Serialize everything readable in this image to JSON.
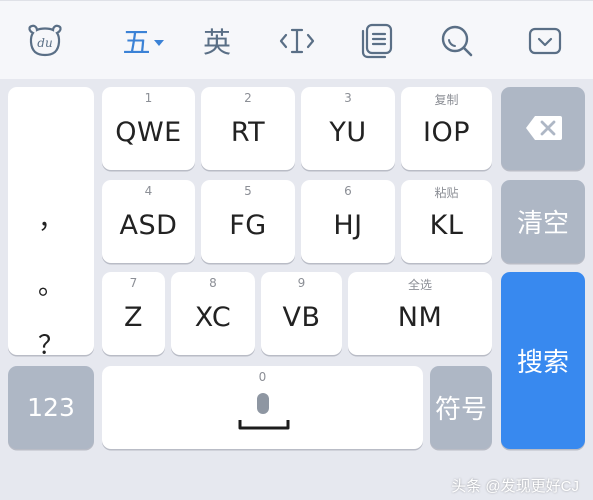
{
  "toolbar": {
    "baidu_logo": "du",
    "wubi_label": "五",
    "english_label": "英",
    "icons": [
      "baidu-logo-icon",
      "cursor-icon",
      "clipboard-icon",
      "search-icon",
      "hide-keyboard-icon"
    ]
  },
  "punctuation": [
    "，",
    "。",
    "？",
    "！"
  ],
  "keys": {
    "qwe": {
      "num": "1",
      "label": "QWE"
    },
    "rt": {
      "num": "2",
      "label": "RT"
    },
    "yu": {
      "num": "3",
      "label": "YU"
    },
    "iop": {
      "num": "复制",
      "label": "IOP"
    },
    "asd": {
      "num": "4",
      "label": "ASD"
    },
    "fg": {
      "num": "5",
      "label": "FG"
    },
    "hj": {
      "num": "6",
      "label": "HJ"
    },
    "kl": {
      "num": "粘贴",
      "label": "KL"
    },
    "z": {
      "num": "7",
      "label": "Z"
    },
    "xc": {
      "num": "8",
      "label": "XC"
    },
    "vb": {
      "num": "9",
      "label": "VB"
    },
    "nm": {
      "num": "全选",
      "label": "NM"
    },
    "space": {
      "num": "0"
    }
  },
  "side": {
    "clear": "清空",
    "search": "搜索",
    "symbols": "符号",
    "numbers": "123"
  },
  "watermark": "头条 @发现更好CJ",
  "colors": {
    "accent": "#3b82d6",
    "search_key": "#3889ef",
    "function_key": "#aeb7c5",
    "keyboard_bg": "#e6e8ef"
  }
}
